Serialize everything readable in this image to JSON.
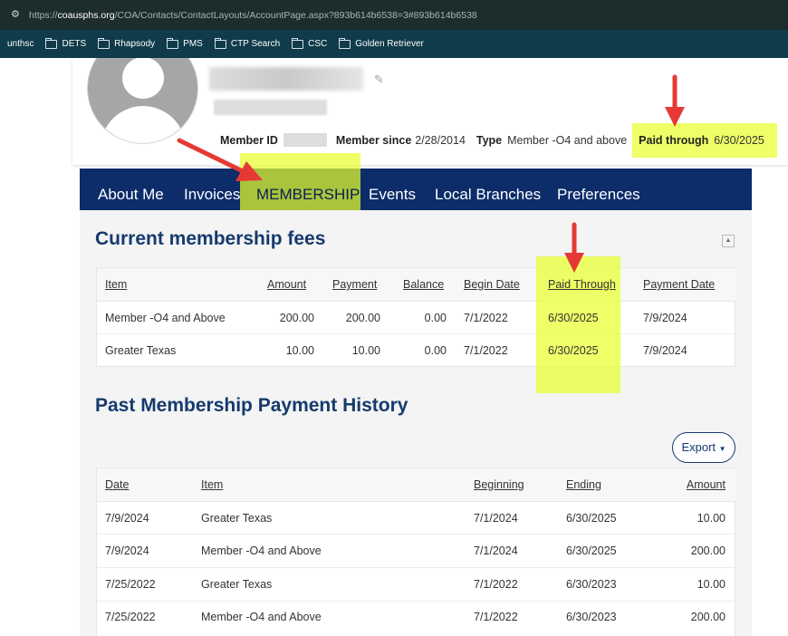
{
  "browser": {
    "url_prefix": "https://",
    "url_host": "coausphs.org",
    "url_path": "/COA/Contacts/ContactLayouts/AccountPage.aspx?893b614b6538=3#893b614b6538"
  },
  "bookmarks": [
    {
      "label": "unthsc",
      "folder": false
    },
    {
      "label": "DETS",
      "folder": true
    },
    {
      "label": "Rhapsody",
      "folder": true
    },
    {
      "label": "PMS",
      "folder": true
    },
    {
      "label": "CTP Search",
      "folder": true
    },
    {
      "label": "CSC",
      "folder": true
    },
    {
      "label": "Golden Retriever",
      "folder": true
    }
  ],
  "profile": {
    "member_id_label": "Member ID",
    "member_since_label": "Member since",
    "member_since_value": "2/28/2014",
    "type_label": "Type",
    "type_value": "Member -O4 and above",
    "paid_through_label": "Paid through",
    "paid_through_value": "6/30/2025"
  },
  "tabs": [
    "About Me",
    "Invoices",
    "MEMBERSHIP",
    "Events",
    "Local Branches",
    "Preferences"
  ],
  "current_fees": {
    "title": "Current membership fees",
    "headers": [
      "Item",
      "Amount",
      "Payment",
      "Balance",
      "Begin Date",
      "Paid Through",
      "Payment Date"
    ],
    "rows": [
      [
        "Member -O4 and Above",
        "200.00",
        "200.00",
        "0.00",
        "7/1/2022",
        "6/30/2025",
        "7/9/2024"
      ],
      [
        "Greater Texas",
        "10.00",
        "10.00",
        "0.00",
        "7/1/2022",
        "6/30/2025",
        "7/9/2024"
      ]
    ]
  },
  "history": {
    "title": "Past Membership Payment History",
    "export_label": "Export",
    "headers": [
      "Date",
      "Item",
      "Beginning",
      "Ending",
      "Amount"
    ],
    "rows": [
      [
        "7/9/2024",
        "Greater Texas",
        "7/1/2024",
        "6/30/2025",
        "10.00"
      ],
      [
        "7/9/2024",
        "Member -O4 and Above",
        "7/1/2024",
        "6/30/2025",
        "200.00"
      ],
      [
        "7/25/2022",
        "Greater Texas",
        "7/1/2022",
        "6/30/2023",
        "10.00"
      ],
      [
        "7/25/2022",
        "Member -O4 and Above",
        "7/1/2022",
        "6/30/2023",
        "200.00"
      ]
    ]
  },
  "colors": {
    "nav": "#0c2c6a",
    "heading": "#153a6e",
    "highlight": "#e8ff2c",
    "arrow": "#e53935"
  }
}
